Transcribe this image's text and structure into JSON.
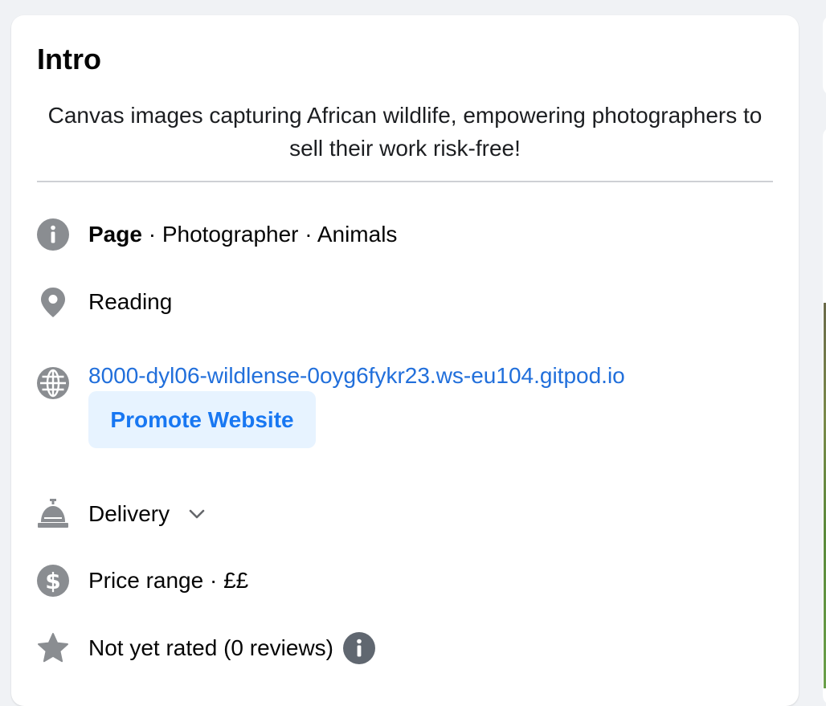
{
  "intro": {
    "title": "Intro",
    "bio": "Canvas images capturing African wildlife, empowering photographers to sell their work risk-free!"
  },
  "details": {
    "page": {
      "icon": "info-icon",
      "type_label": "Page",
      "rest": " · Photographer · Animals"
    },
    "location": {
      "icon": "location-pin-icon",
      "text": "Reading"
    },
    "website": {
      "icon": "globe-icon",
      "url": "8000-dyl06-wildlense-0oyg6fykr23.ws-eu104.gitpod.io",
      "promote_label": "Promote Website"
    },
    "delivery": {
      "icon": "service-bell-icon",
      "text": "Delivery",
      "chevron_icon": "chevron-down-icon"
    },
    "price": {
      "icon": "dollar-circle-icon",
      "text": "Price range · ££"
    },
    "rating": {
      "icon": "star-icon",
      "text": "Not yet rated (0 reviews)",
      "info_icon": "info-icon"
    }
  },
  "colors": {
    "background": "#f0f2f5",
    "card": "#ffffff",
    "icon_gray": "#8a8d91",
    "link_blue": "#216fdb",
    "button_bg": "#e7f3ff",
    "button_text": "#1877f2",
    "divider": "#ced0d4"
  }
}
